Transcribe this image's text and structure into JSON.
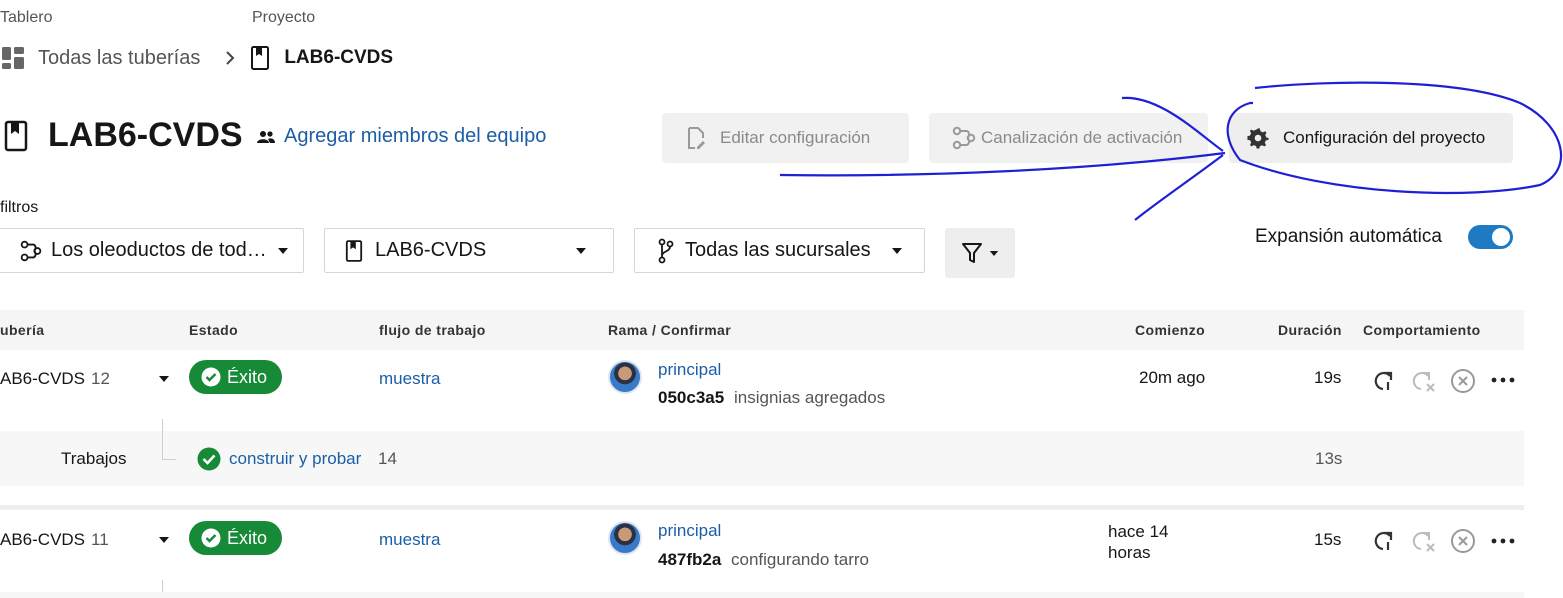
{
  "breadcrumbs": {
    "top_labels": [
      "Tablero",
      "Proyecto"
    ],
    "items": [
      "Todas las tuberías",
      "LAB6-CVDS"
    ]
  },
  "project": {
    "title": "LAB6-CVDS",
    "add_members": "Agregar miembros del equipo"
  },
  "toolbar": {
    "edit_config": "Editar configuración",
    "trigger_pipeline": "Canalización de activación",
    "project_settings": "Configuración del proyecto"
  },
  "filters": {
    "label": "filtros",
    "pipelines_select": "Los oleoductos de tod…",
    "project_select": "LAB6-CVDS",
    "branches_select": "Todas las sucursales",
    "auto_expand_label": "Expansión automática",
    "auto_expand_on": true
  },
  "table": {
    "headers": [
      "ubería",
      "Estado",
      "flujo de trabajo",
      "Rama / Confirmar",
      "Comienzo",
      "Duración",
      "Comportamiento"
    ],
    "rows": [
      {
        "pipeline": "AB6-CVDS",
        "number": "12",
        "status": "Éxito",
        "workflow": "muestra",
        "branch": "principal",
        "commit_hash": "050c3a5",
        "commit_msg": "insignias agregados",
        "start": "20m ago",
        "duration": "19s",
        "jobs": {
          "label": "Trabajos",
          "job_name": "construir y probar",
          "job_number": "14",
          "job_duration": "13s"
        }
      },
      {
        "pipeline": "AB6-CVDS",
        "number": "11",
        "status": "Éxito",
        "workflow": "muestra",
        "branch": "principal",
        "commit_hash": "487fb2a",
        "commit_msg": "configurando tarro",
        "start": "hace 14 horas",
        "duration": "15s"
      }
    ]
  },
  "colors": {
    "success": "#168a36",
    "link": "#1c5ea6",
    "toggle": "#1f7ac4",
    "annotation": "#1f1fd6"
  }
}
